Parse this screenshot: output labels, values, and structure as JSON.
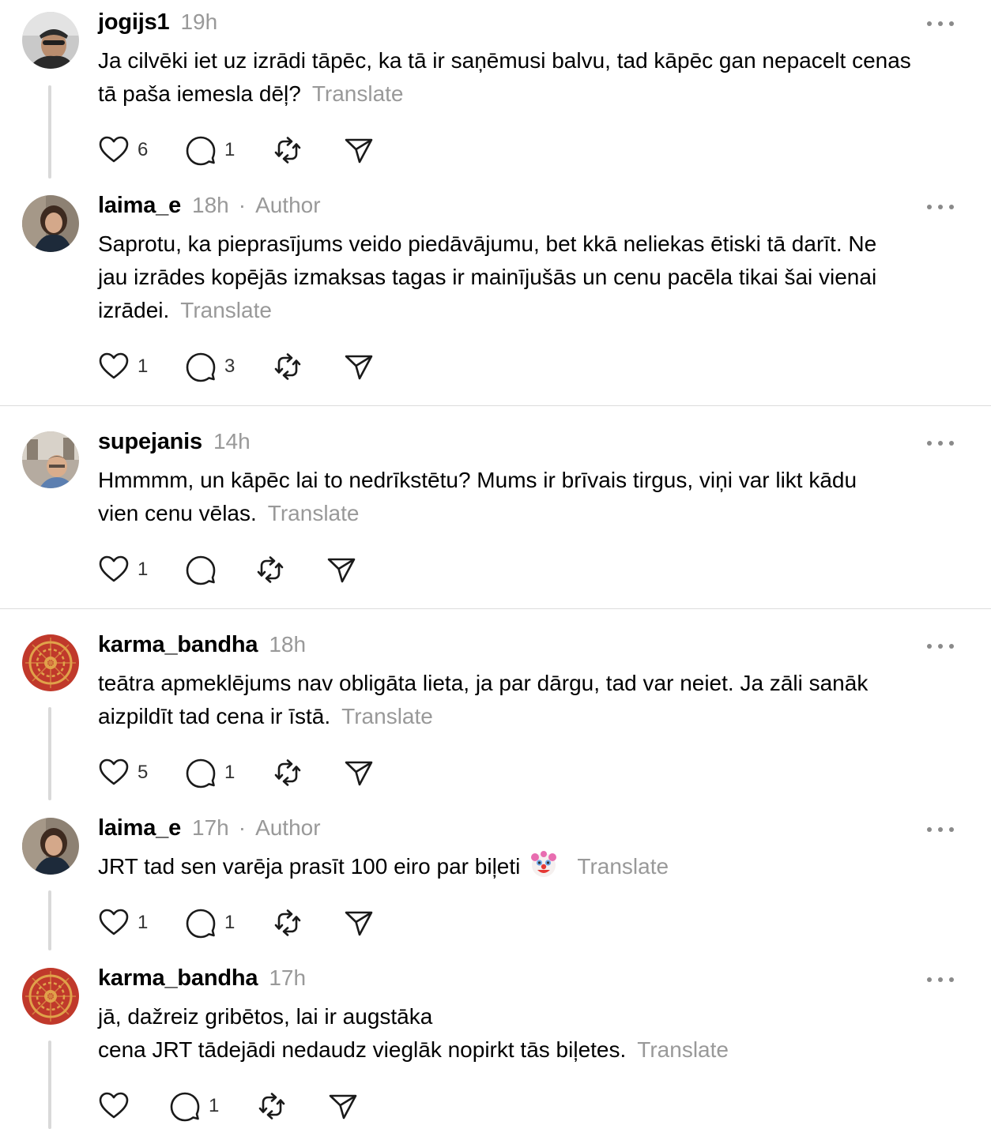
{
  "translate_label": "Translate",
  "author_label": "Author",
  "dot_separator": "·",
  "icons": {
    "more": "more-icon",
    "like": "heart-icon",
    "reply": "comment-icon",
    "repost": "repost-icon",
    "share": "send-icon"
  },
  "posts": [
    {
      "username": "jogijs1",
      "time": "19h",
      "is_author": false,
      "text_lines": [
        "Ja cilvēki iet uz izrādi tāpēc, ka tā ir saņēmusi balvu, tad kāpēc gan nepacelt cenas",
        "tā paša iemesla dēļ?"
      ],
      "likes": "6",
      "replies": "1"
    },
    {
      "username": "laima_e",
      "time": "18h",
      "is_author": true,
      "text_lines": [
        "Saprotu, ka pieprasījums veido piedāvājumu, bet kkā neliekas ētiski tā darīt. Ne",
        "jau izrādes kopējās izmaksas tagas ir mainījušās un cenu pacēla tikai šai vienai",
        "izrādei."
      ],
      "likes": "1",
      "replies": "3"
    },
    {
      "username": "supejanis",
      "time": "14h",
      "is_author": false,
      "text_lines": [
        "Hmmmm, un kāpēc lai to nedrīkstētu? Mums ir brīvais tirgus, viņi var likt kādu",
        "vien cenu vēlas."
      ],
      "likes": "1",
      "replies": ""
    },
    {
      "username": "karma_bandha",
      "time": "18h",
      "is_author": false,
      "text_lines": [
        "teātra apmeklējums nav obligāta lieta, ja par dārgu, tad var neiet. Ja zāli sanāk",
        "aizpildīt tad cena ir īstā."
      ],
      "likes": "5",
      "replies": "1"
    },
    {
      "username": "laima_e",
      "time": "17h",
      "is_author": true,
      "text_lines": [
        "JRT tad sen varēja prasīt 100 eiro par biļeti"
      ],
      "emoji": "clown-face-icon",
      "likes": "1",
      "replies": "1"
    },
    {
      "username": "karma_bandha",
      "time": "17h",
      "is_author": false,
      "text_lines": [
        "jā, dažreiz gribētos, lai ir augstāka",
        "cena JRT tādejādi nedaudz vieglāk nopirkt tās biļetes."
      ],
      "likes": "",
      "replies": "1"
    }
  ]
}
